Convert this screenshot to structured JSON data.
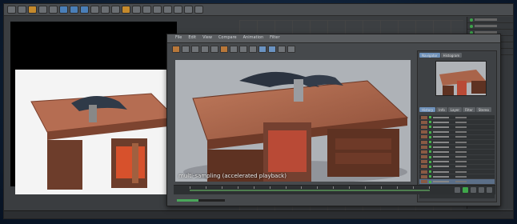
{
  "render": {
    "caption": "multi-sampling (accelerated playback)"
  },
  "picture_viewer": {
    "menu": [
      "File",
      "Edit",
      "View",
      "Compare",
      "Animation",
      "Filter"
    ],
    "navigator_tabs": [
      "Navigator",
      "Histogram"
    ],
    "history_tabs": [
      "History",
      "Info",
      "Layer",
      "Filter",
      "Stereo"
    ],
    "history_rows": 14,
    "progress_fraction": 0.45
  },
  "colors": {
    "accent_green": "#3fa74a",
    "desk_wood": "#a8624a",
    "bg_blue": "#0d1e33"
  },
  "icons": [
    "play-icon",
    "stop-icon",
    "prev-frame-icon",
    "next-frame-icon",
    "record-icon"
  ]
}
